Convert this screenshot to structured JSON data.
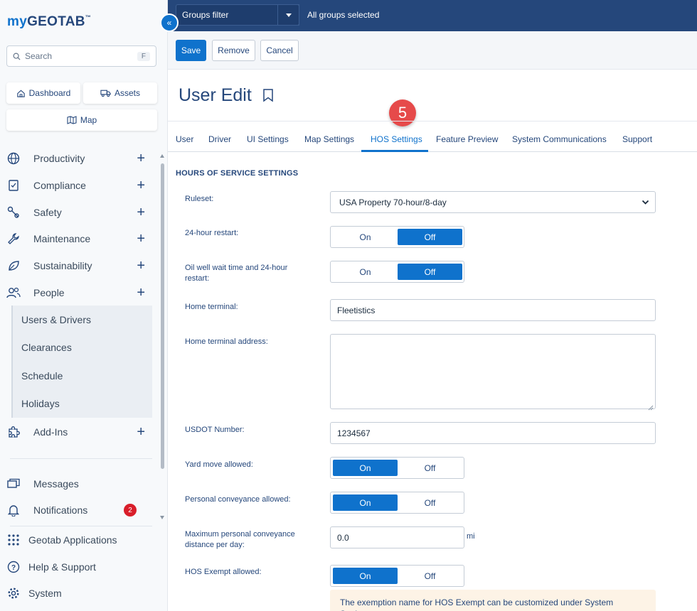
{
  "app": {
    "logo_prefix": "my",
    "logo_main": "GEOTAB",
    "logo_tm": "™"
  },
  "sidebar": {
    "search_placeholder": "Search",
    "search_shortcut": "F",
    "quick_links": [
      {
        "label": "Dashboard",
        "icon": "home-icon"
      },
      {
        "label": "Assets",
        "icon": "truck-icon"
      },
      {
        "label": "Map",
        "icon": "map-icon"
      }
    ],
    "items": [
      {
        "label": "Productivity",
        "icon": "globe-icon"
      },
      {
        "label": "Compliance",
        "icon": "clipboard-icon"
      },
      {
        "label": "Safety",
        "icon": "safety-icon"
      },
      {
        "label": "Maintenance",
        "icon": "wrench-icon"
      },
      {
        "label": "Sustainability",
        "icon": "leaf-icon"
      },
      {
        "label": "People",
        "icon": "people-icon"
      }
    ],
    "people_sub": [
      "Users & Drivers",
      "Clearances",
      "Schedule",
      "Holidays"
    ],
    "addins": "Add-Ins",
    "messages": "Messages",
    "notifications": "Notifications",
    "notifications_count": "2",
    "geotab_apps": "Geotab Applications",
    "help": "Help & Support",
    "system": "System",
    "collapse_glyph": "«"
  },
  "topbar": {
    "groups_label": "Groups filter",
    "groups_status": "All groups selected"
  },
  "toolbar": {
    "save": "Save",
    "remove": "Remove",
    "cancel": "Cancel"
  },
  "page": {
    "title": "User Edit",
    "step_number": "5"
  },
  "tabs": [
    "User",
    "Driver",
    "UI Settings",
    "Map Settings",
    "HOS Settings",
    "Feature Preview",
    "System Communications",
    "Support"
  ],
  "form": {
    "section_title": "HOURS OF SERVICE SETTINGS",
    "ruleset_label": "Ruleset:",
    "ruleset_value": "USA Property 70-hour/8-day",
    "restart_label": "24-hour restart:",
    "oilwell_label": "Oil well wait time and 24-hour restart:",
    "home_terminal_label": "Home terminal:",
    "home_terminal_value": "Fleetistics",
    "home_address_label": "Home terminal address:",
    "usdot_label": "USDOT Number:",
    "usdot_value": "1234567",
    "yard_label": "Yard move allowed:",
    "pc_label": "Personal conveyance allowed:",
    "max_pc_label": "Maximum personal conveyance distance per day:",
    "max_pc_value": "0.0",
    "max_pc_unit": "mi",
    "hos_exempt_label": "HOS Exempt allowed:",
    "on": "On",
    "off": "Off",
    "note": "The exemption name for HOS Exempt can be customized under System Settings."
  },
  "colors": {
    "brand": "#25477b",
    "accent": "#0f72cc",
    "badge": "#d91e2a",
    "step_marker": "#e64a4a"
  }
}
